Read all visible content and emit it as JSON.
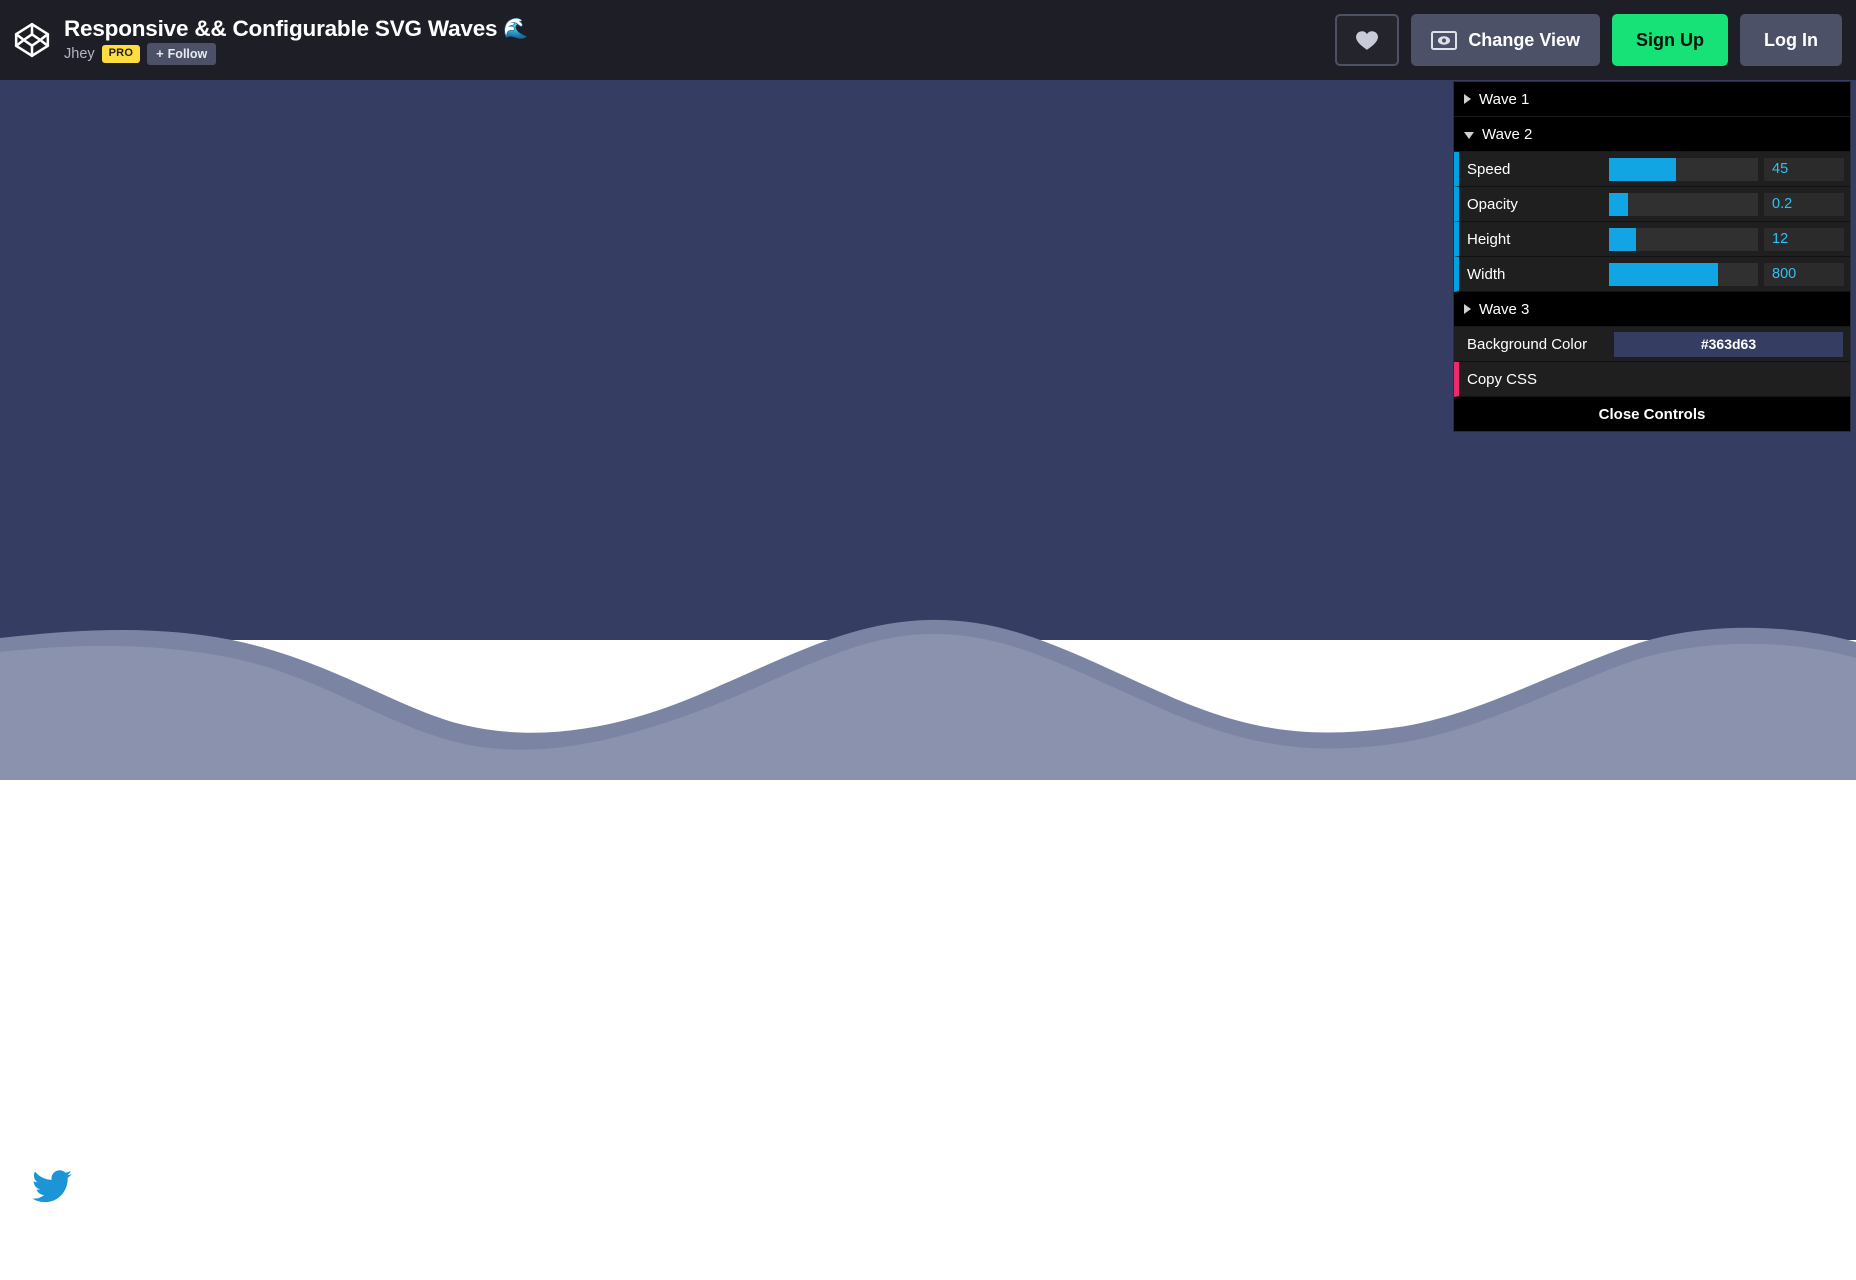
{
  "header": {
    "logo_icon": "codepen-logo-icon",
    "pen_title": "Responsive && Configurable SVG Waves",
    "pen_title_emoji": "🌊",
    "author": "Jhey",
    "pro_badge": "PRO",
    "follow_plus": "+",
    "follow_label": "Follow",
    "heart_icon": "heart-icon",
    "change_view_icon": "eye-icon",
    "change_view_label": "Change View",
    "signup_label": "Sign Up",
    "login_label": "Log In",
    "colors": {
      "header_bg": "#1e1f26",
      "signup_green": "#17e277",
      "button_grey": "#4c5168",
      "pro_yellow": "#ffdd40"
    }
  },
  "controls": {
    "wave1": {
      "label": "Wave 1",
      "expanded": false
    },
    "wave2": {
      "label": "Wave 2",
      "expanded": true,
      "params": [
        {
          "label": "Speed",
          "value": "45",
          "fill_percent": 45
        },
        {
          "label": "Opacity",
          "value": "0.2",
          "fill_percent": 13
        },
        {
          "label": "Height",
          "value": "12",
          "fill_percent": 18
        },
        {
          "label": "Width",
          "value": "800",
          "fill_percent": 73
        }
      ]
    },
    "wave3": {
      "label": "Wave 3",
      "expanded": false
    },
    "background_color": {
      "label": "Background Color",
      "value": "#363d63"
    },
    "copy_css": {
      "label": "Copy CSS"
    },
    "close_controls": {
      "label": "Close Controls"
    },
    "accent_blue": "#12a5e3",
    "accent_pink": "#ed2a6d"
  },
  "preview": {
    "background_color": "#363d63",
    "wave_front_color": "#8b92ae",
    "wave_back_color": "#7c84a4",
    "page_color": "#ffffff",
    "twitter_icon": "twitter-bird-icon",
    "twitter_color": "#1b95d6"
  }
}
